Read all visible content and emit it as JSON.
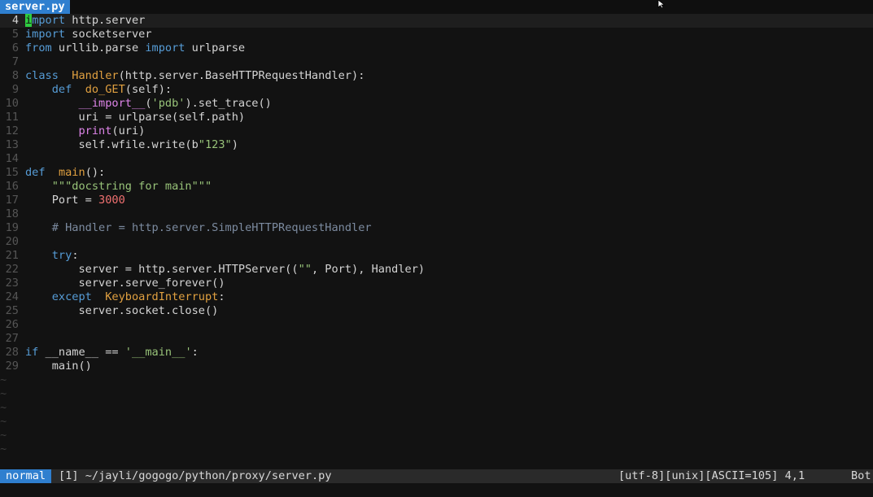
{
  "tab": {
    "label": "server.py"
  },
  "code_lines": [
    {
      "num": "4",
      "current": true,
      "tokens": [
        [
          "cursor",
          "i"
        ],
        [
          "k",
          "mport"
        ],
        [
          "",
          "  http.server"
        ]
      ]
    },
    {
      "num": "5",
      "tokens": [
        [
          "k",
          "import"
        ],
        [
          "",
          "  socketserver"
        ]
      ]
    },
    {
      "num": "6",
      "tokens": [
        [
          "k",
          "from"
        ],
        [
          "",
          "  urllib.parse "
        ],
        [
          "k",
          "import"
        ],
        [
          "",
          "  urlparse"
        ]
      ]
    },
    {
      "num": "7",
      "tokens": []
    },
    {
      "num": "8",
      "tokens": [
        [
          "k",
          "class"
        ],
        [
          "",
          "  "
        ],
        [
          "f",
          "Handler"
        ],
        [
          "",
          "(http.server.BaseHTTPRequestHandler):"
        ]
      ]
    },
    {
      "num": "9",
      "tokens": [
        [
          "",
          "    "
        ],
        [
          "k",
          "def"
        ],
        [
          "",
          "  "
        ],
        [
          "f",
          "do_GET"
        ],
        [
          "",
          "(self):"
        ]
      ]
    },
    {
      "num": "10",
      "tokens": [
        [
          "",
          "        "
        ],
        [
          "b",
          "__import__"
        ],
        [
          "",
          "("
        ],
        [
          "s",
          "'pdb'"
        ],
        [
          "",
          ").set_trace()"
        ]
      ]
    },
    {
      "num": "11",
      "tokens": [
        [
          "",
          "        uri = urlparse(self.path)"
        ]
      ]
    },
    {
      "num": "12",
      "tokens": [
        [
          "",
          "        "
        ],
        [
          "b",
          "print"
        ],
        [
          "",
          "(uri)"
        ]
      ]
    },
    {
      "num": "13",
      "tokens": [
        [
          "",
          "        self.wfile.write(b"
        ],
        [
          "s",
          "\"123\""
        ],
        [
          "",
          ")"
        ]
      ]
    },
    {
      "num": "14",
      "tokens": []
    },
    {
      "num": "15",
      "tokens": [
        [
          "k",
          "def"
        ],
        [
          "",
          "  "
        ],
        [
          "f",
          "main"
        ],
        [
          "",
          "():"
        ]
      ]
    },
    {
      "num": "16",
      "tokens": [
        [
          "",
          "    "
        ],
        [
          "s",
          "\"\"\"docstring for main\"\"\""
        ]
      ]
    },
    {
      "num": "17",
      "tokens": [
        [
          "",
          "    Port = "
        ],
        [
          "n",
          "3000"
        ]
      ]
    },
    {
      "num": "18",
      "tokens": []
    },
    {
      "num": "19",
      "tokens": [
        [
          "",
          "    "
        ],
        [
          "c",
          "# Handler = http.server.SimpleHTTPRequestHandler"
        ]
      ]
    },
    {
      "num": "20",
      "tokens": []
    },
    {
      "num": "21",
      "tokens": [
        [
          "",
          "    "
        ],
        [
          "k",
          "try"
        ],
        [
          "",
          ":"
        ]
      ]
    },
    {
      "num": "22",
      "tokens": [
        [
          "",
          "        server = http.server.HTTPServer(("
        ],
        [
          "s",
          "\"\""
        ],
        [
          "",
          ", Port), Handler)"
        ]
      ]
    },
    {
      "num": "23",
      "tokens": [
        [
          "",
          "        server.serve_forever()"
        ]
      ]
    },
    {
      "num": "24",
      "tokens": [
        [
          "",
          "    "
        ],
        [
          "k",
          "except"
        ],
        [
          "",
          "  "
        ],
        [
          "f",
          "KeyboardInterrupt"
        ],
        [
          "",
          ":"
        ]
      ]
    },
    {
      "num": "25",
      "tokens": [
        [
          "",
          "        server.socket.close()"
        ]
      ]
    },
    {
      "num": "26",
      "tokens": []
    },
    {
      "num": "27",
      "tokens": []
    },
    {
      "num": "28",
      "tokens": [
        [
          "k",
          "if"
        ],
        [
          "",
          "  __name__ == "
        ],
        [
          "s",
          "'__main__'"
        ],
        [
          "",
          ":"
        ]
      ]
    },
    {
      "num": "29",
      "tokens": [
        [
          "",
          "    main()"
        ]
      ]
    }
  ],
  "empty_line_marker": "~",
  "empty_line_count": 6,
  "statusline": {
    "mode": "normal",
    "file": "[1] ~/jayli/gogogo/python/proxy/server.py",
    "encoding": "[utf-8][unix][ASCII=105] 4,1",
    "position": "Bot"
  }
}
